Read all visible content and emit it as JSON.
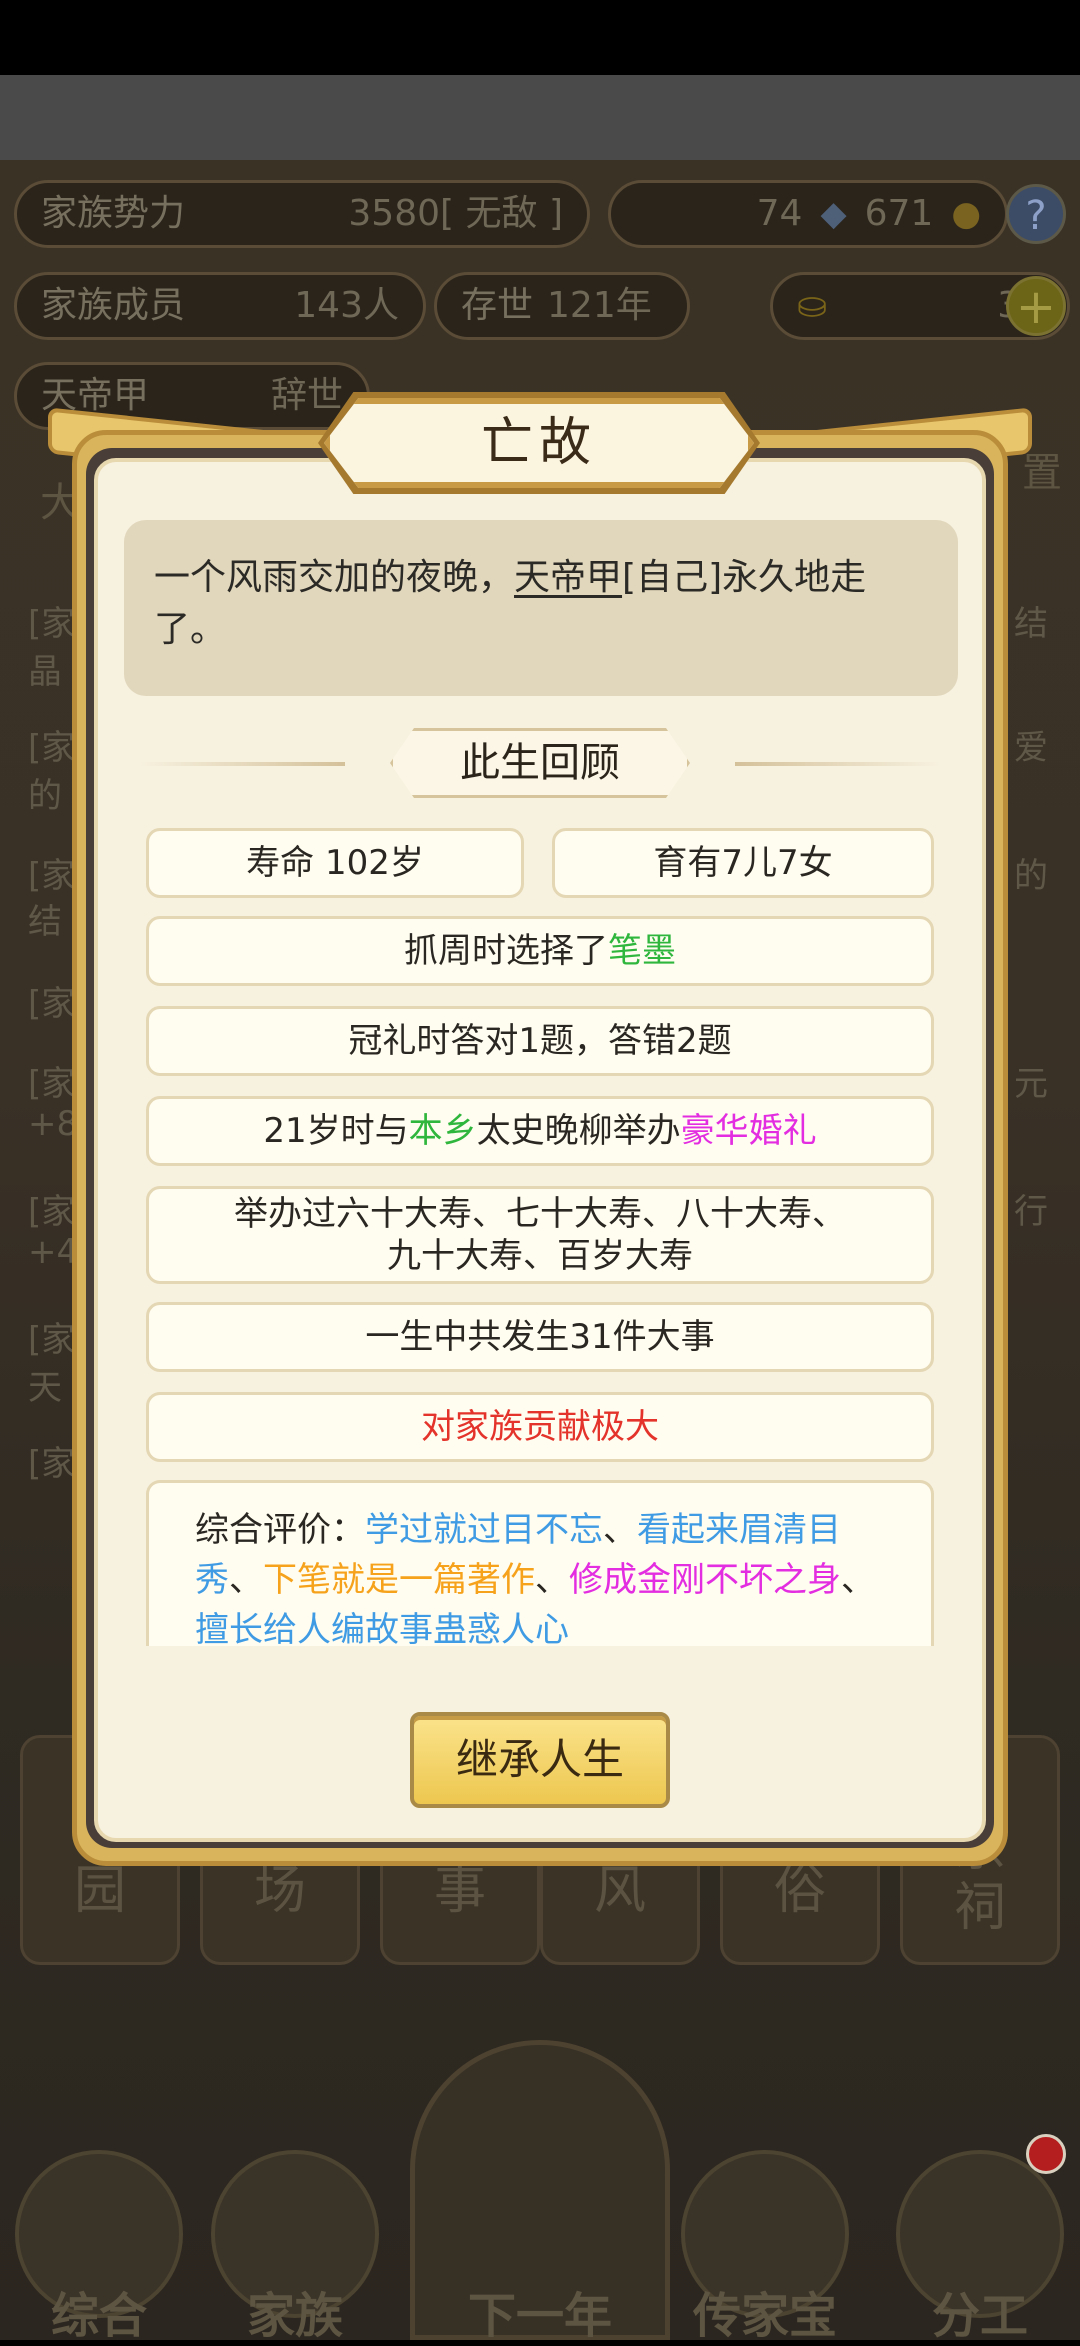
{
  "background": {
    "stats": {
      "family_power_label": "家族势力",
      "family_power_value": "3580",
      "family_power_rank": "[ 无敌 ]",
      "silver": "74",
      "copper": "671",
      "members_label": "家族成员",
      "members_value": "143人",
      "existence_label": "存世",
      "existence_value": "121年",
      "gold": "36",
      "leader_name": "天帝甲",
      "leader_status": "辞世"
    },
    "log_rows": [
      {
        "left": "[家",
        "right": "结"
      },
      {
        "left": "晶",
        "right": ""
      },
      {
        "left": "[家",
        "right": "爱"
      },
      {
        "left": "的",
        "right": ""
      },
      {
        "left": "[家",
        "right": "的"
      },
      {
        "left": "结",
        "right": ""
      },
      {
        "left": "[家",
        "right": ""
      },
      {
        "left": "[家",
        "right": "元"
      },
      {
        "left": "+8",
        "right": ""
      },
      {
        "left": "[家",
        "right": "行"
      },
      {
        "left": "+4",
        "right": ""
      },
      {
        "left": "[家",
        "right": ""
      },
      {
        "left": "天",
        "right": ""
      },
      {
        "left": "[家",
        "right": ""
      }
    ],
    "partial_label_left": "大",
    "partial_label_right": "置",
    "tiles": [
      "园",
      "场",
      "事",
      "风",
      "俗",
      "宗\n祠"
    ],
    "nav": [
      "综合",
      "家族",
      "下一年",
      "传家宝",
      "分工"
    ]
  },
  "dialog": {
    "title": "亡故",
    "message_prefix": "一个风雨交加的夜晚，",
    "message_name": "天帝甲",
    "message_suffix": "[自己]永久地走了。",
    "section_title": "此生回顾",
    "lifespan": "寿命 102岁",
    "children": "育有7儿7女",
    "zhuazhou_prefix": "抓周时选择了",
    "zhuazhou_item": "笔墨",
    "capping": "冠礼时答对1题，答错2题",
    "wedding_prefix": "21岁时与",
    "wedding_place": "本乡",
    "wedding_mid": "太史晚柳举办",
    "wedding_type": "豪华婚礼",
    "birthdays_line1": "举办过六十大寿、七十大寿、八十大寿、",
    "birthdays_line2": "九十大寿、百岁大寿",
    "events": "一生中共发生31件大事",
    "contribution": "对家族贡献极大",
    "eval_label": "综合评价：",
    "eval_1": "学过就过目不忘",
    "sep": "、",
    "eval_2": "看起来眉清目秀",
    "eval_3": "下笔就是一篇著作",
    "eval_4": "修成金刚不坏之身",
    "eval_5": "擅长给人编故事蛊惑人心",
    "inherit_button": "继承人生"
  },
  "colors": {
    "green": "#2fb63c",
    "magenta": "#e32de0",
    "red": "#e3332a",
    "blue": "#3f9be3",
    "orange": "#f6a21b"
  }
}
